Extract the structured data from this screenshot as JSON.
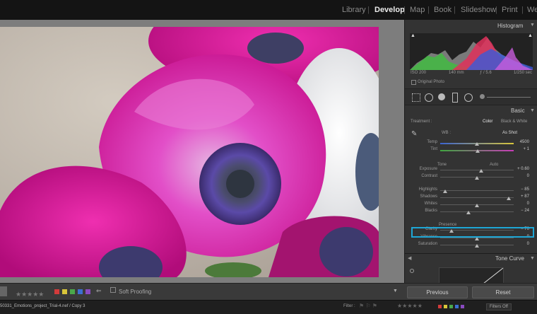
{
  "modules": [
    "Library",
    "Develop",
    "Map",
    "Book",
    "Slideshow",
    "Print",
    "We"
  ],
  "active_module": "Develop",
  "histogram": {
    "title": "Histogram",
    "iso": "ISO 200",
    "focal": "140 mm",
    "aperture": "ƒ / 5.6",
    "shutter": "1/250 sec",
    "original_photo": "Original Photo"
  },
  "basic": {
    "title": "Basic",
    "treatment_label": "Treatment :",
    "color": "Color",
    "bw": "Black & White",
    "wb_label": "WB :",
    "wb_value": "As Shot",
    "tone_label": "Tone",
    "auto": "Auto",
    "presence_label": "Presence",
    "sliders": [
      {
        "label": "Temp",
        "value": "4500",
        "pos": 0.5
      },
      {
        "label": "Tint",
        "value": "+ 1",
        "pos": 0.51
      },
      {
        "label": "Exposure",
        "value": "+ 0.60",
        "pos": 0.56
      },
      {
        "label": "Contrast",
        "value": "0",
        "pos": 0.5
      },
      {
        "label": "Highlights",
        "value": "− 85",
        "pos": 0.07
      },
      {
        "label": "Shadows",
        "value": "+ 87",
        "pos": 0.93
      },
      {
        "label": "Whites",
        "value": "0",
        "pos": 0.5
      },
      {
        "label": "Blacks",
        "value": "− 24",
        "pos": 0.38
      },
      {
        "label": "Clarity",
        "value": "− 70",
        "pos": 0.15
      },
      {
        "label": "Vibrance",
        "value": "0",
        "pos": 0.5
      },
      {
        "label": "Saturation",
        "value": "0",
        "pos": 0.5
      }
    ]
  },
  "tone_curve": {
    "title": "Tone Curve"
  },
  "buttons": {
    "previous": "Previous",
    "reset": "Reset"
  },
  "toolbar": {
    "soft_proofing": "Soft Proofing"
  },
  "filmstrip": {
    "filename": "50331_Emotions_project_Trial-4.nef / Copy 3",
    "filter_label": "Filter :",
    "filters_off": "Filters Off"
  },
  "colors": {
    "accent_highlight": "#1ea7d6",
    "label_red": "#d23b3b",
    "label_yellow": "#d8c53a",
    "label_green": "#4aa84a",
    "label_blue": "#3c6fd0",
    "label_purple": "#8a4ac0"
  }
}
